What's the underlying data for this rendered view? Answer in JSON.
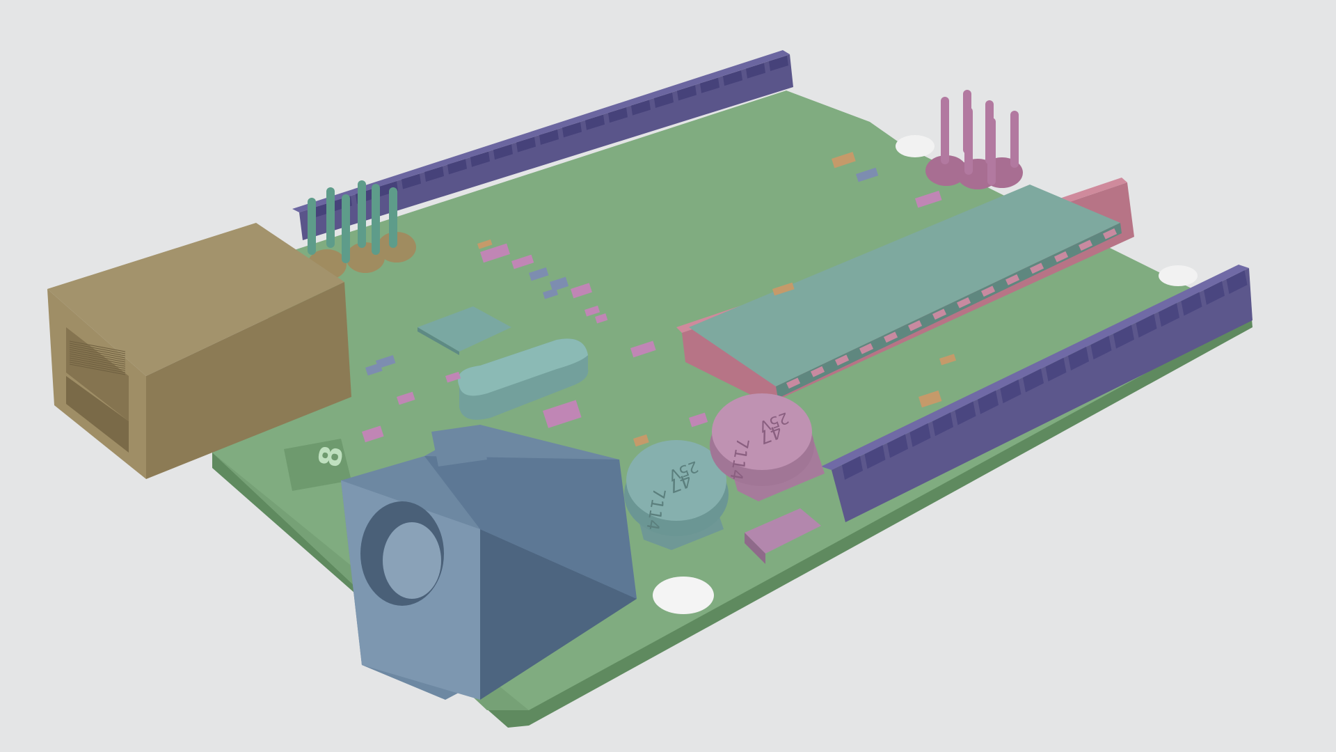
{
  "scene": {
    "background": "#e4e5e6",
    "colors": {
      "pcb": "#7eaa7e",
      "pcb_edge": "#6a946a",
      "headers": "#5f5a90",
      "usb": "#9a8a66",
      "chip": "#78a49c",
      "socket": "#c07a8e",
      "barrel_jack": "#6f8aa4",
      "cap_teal": "#7fa7a6",
      "cap_pink": "#b58aa8",
      "pins_teal": "#5e9c8a",
      "pins_pink": "#b279a0",
      "smd_pink": "#c086b5",
      "smd_orange": "#c59a6a",
      "smd_blue": "#7d8db0"
    }
  },
  "labels": {
    "cap_left_value": "47",
    "cap_left_voltage": "25V",
    "cap_left_code": "7114",
    "cap_right_value": "47",
    "cap_right_voltage": "25V",
    "cap_right_code": "7114",
    "silk_number": "8"
  }
}
